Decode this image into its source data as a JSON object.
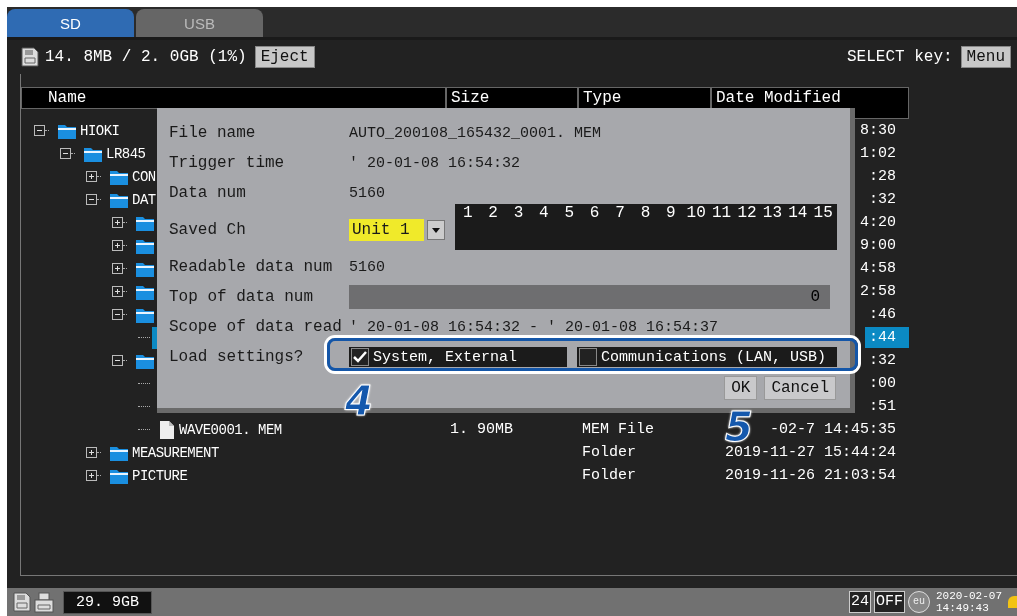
{
  "tabs": [
    {
      "label": "SD",
      "selected": true
    },
    {
      "label": "USB",
      "selected": false
    }
  ],
  "media": {
    "usage": "14. 8MB / 2. 0GB (1%)",
    "eject": "Eject",
    "select_key_label": "SELECT key:",
    "select_key_button": "Menu"
  },
  "file_table": {
    "columns": [
      "Name",
      "Size",
      "Type",
      "Date Modified"
    ],
    "tree": [
      {
        "name": "HIOKI",
        "kind": "folder",
        "expanded": true,
        "selected": false,
        "date": "8:30",
        "children": [
          {
            "name": "LR845",
            "kind": "folder",
            "expanded": true,
            "selected": false,
            "date": "1:02",
            "children": [
              {
                "name": "CON",
                "kind": "folder",
                "expanded": false,
                "selected": false,
                "date": ":28"
              },
              {
                "name": "DAT",
                "kind": "folder",
                "expanded": true,
                "selected": false,
                "date": ":32",
                "children": [
                  {
                    "kind": "folder",
                    "expanded": false,
                    "selected": false,
                    "date": "4:20"
                  },
                  {
                    "kind": "folder",
                    "expanded": false,
                    "selected": false,
                    "date": "9:00"
                  },
                  {
                    "kind": "folder",
                    "expanded": false,
                    "selected": false,
                    "date": "4:58"
                  },
                  {
                    "kind": "folder",
                    "expanded": false,
                    "selected": false,
                    "date": "2:58"
                  },
                  {
                    "kind": "folder",
                    "expanded": true,
                    "selected": false,
                    "date": ":46",
                    "children": [
                      {
                        "kind": "item",
                        "selected": true,
                        "date": ":44"
                      }
                    ]
                  },
                  {
                    "kind": "folder",
                    "expanded": true,
                    "selected": false,
                    "date": ":32",
                    "children": [
                      {
                        "kind": "item",
                        "selected": false,
                        "date": ":00"
                      },
                      {
                        "kind": "item",
                        "selected": false,
                        "date": ":51"
                      },
                      {
                        "name": "WAVE0001. MEM",
                        "kind": "file",
                        "selected": false,
                        "size": "1. 90MB",
                        "type": "MEM File",
                        "date": "-02-7 14:45:35"
                      }
                    ]
                  }
                ]
              },
              {
                "name": "MEASUREMENT",
                "kind": "folder",
                "expanded": false,
                "selected": false,
                "type": "Folder",
                "date": "2019-11-27 15:44:24"
              },
              {
                "name": "PICTURE",
                "kind": "folder",
                "expanded": false,
                "selected": false,
                "type": "Folder",
                "date": "2019-11-26 21:03:54"
              }
            ]
          }
        ]
      }
    ]
  },
  "dialog": {
    "rows": [
      {
        "kind": "text",
        "label": "File name",
        "value": "AUTO_200108_165432_0001. MEM"
      },
      {
        "kind": "text",
        "label": "Trigger time",
        "value": "' 20-01-08 16:54:32"
      },
      {
        "kind": "text",
        "label": "Data num",
        "value": "5160"
      },
      {
        "kind": "channels",
        "label": "Saved Ch",
        "value": "Unit 1",
        "channels": [
          "1",
          "2",
          "3",
          "4",
          "5",
          "6",
          "7",
          "8",
          "9",
          "10",
          "11",
          "12",
          "13",
          "14",
          "15"
        ]
      },
      {
        "kind": "text",
        "label": "Readable data num",
        "value": "5160"
      },
      {
        "kind": "field",
        "label": "Top of data num",
        "value": "0"
      },
      {
        "kind": "text",
        "label": "Scope of data read",
        "value": "' 20-01-08 16:54:32 - ' 20-01-08 16:54:37"
      },
      {
        "kind": "checks",
        "label": "Load settings?",
        "options": [
          {
            "label": "System, External",
            "checked": true
          },
          {
            "label": "Communications (LAN, USB)",
            "checked": false
          }
        ]
      }
    ],
    "buttons": [
      "OK",
      "Cancel"
    ]
  },
  "annotations": [
    {
      "number": "4"
    },
    {
      "number": "5"
    }
  ],
  "status_bar": {
    "free_space": "29. 9GB",
    "indicator_hours": "24",
    "indicator_power": "OFF",
    "badge": "eu",
    "date": "2020-02-07",
    "time": "14:49:43"
  }
}
